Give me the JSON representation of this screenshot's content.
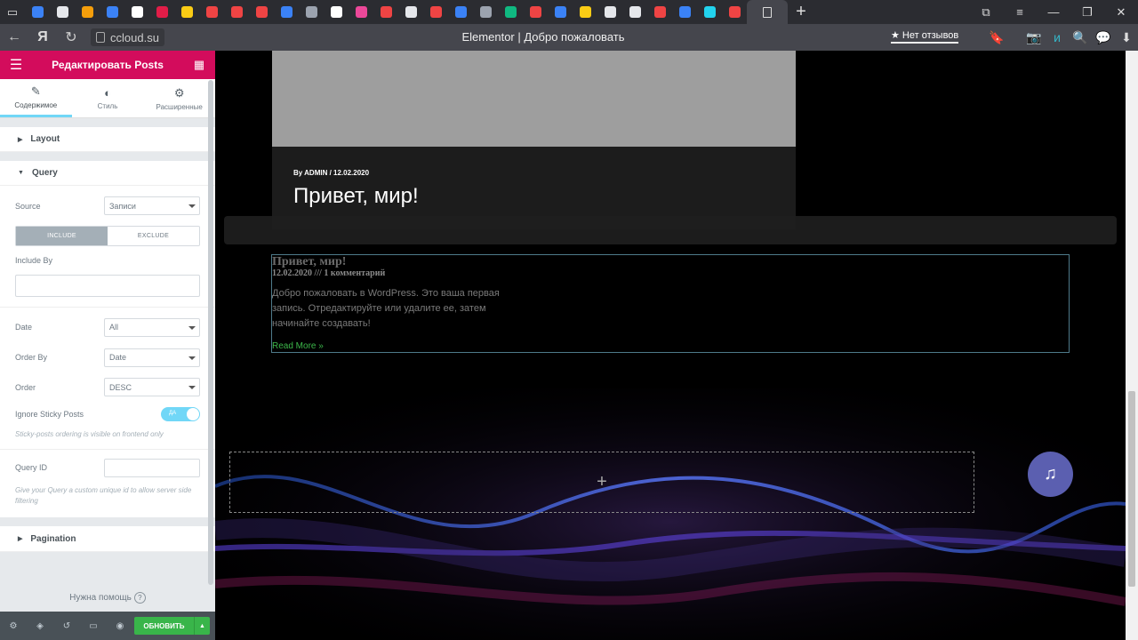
{
  "browser": {
    "url": "ccloud.su",
    "title": "Elementor | Добро пожаловать",
    "reviews": "Нет отзывов",
    "tabs_colors": [
      "#3b82f6",
      "#e5e7eb",
      "#f59e0b",
      "#3b82f6",
      "#ffffff",
      "#e11d48",
      "#facc15",
      "#ef4444",
      "#ef4444",
      "#ef4444",
      "#3b82f6",
      "#9ca3af",
      "#ffffff",
      "#ec4899",
      "#ef4444",
      "#e5e7eb",
      "#ef4444",
      "#3b82f6",
      "#9ca3af",
      "#10b981",
      "#ef4444",
      "#3b82f6",
      "#facc15",
      "#e5e7eb",
      "#e5e7eb",
      "#ef4444",
      "#3b82f6",
      "#22d3ee",
      "#ef4444"
    ]
  },
  "panel": {
    "title": "Редактировать Posts",
    "tabs": [
      {
        "label": "Содержимое"
      },
      {
        "label": "Стиль"
      },
      {
        "label": "Расширенные"
      }
    ],
    "layout_label": "Layout",
    "query_label": "Query",
    "source_label": "Source",
    "source_value": "Записи",
    "include_label": "INCLUDE",
    "exclude_label": "EXCLUDE",
    "include_by_label": "Include By",
    "date_label": "Date",
    "date_value": "All",
    "order_by_label": "Order By",
    "order_by_value": "Date",
    "order_label": "Order",
    "order_value": "DESC",
    "sticky_label": "Ignore Sticky Posts",
    "sticky_toggle": "ДА",
    "sticky_hint": "Sticky-posts ordering is visible on frontend only",
    "query_id_label": "Query ID",
    "query_id_hint": "Give your Query a custom unique id to allow server side filtering",
    "pagination_label": "Pagination",
    "help": "Нужна помощь",
    "update_button": "ОБНОВИТЬ"
  },
  "preview": {
    "card_meta": "By ADMIN  /  12.02.2020",
    "card_title": "Привет, мир!",
    "post_title": "Привет, мир!",
    "post_meta": "12.02.2020 /// 1 комментарий",
    "post_excerpt": "Добро пожаловать в WordPress. Это ваша первая запись. Отредактируйте или удалите ее, затем начинайте создавать!",
    "read_more": "Read More »",
    "add_symbol": "+"
  }
}
